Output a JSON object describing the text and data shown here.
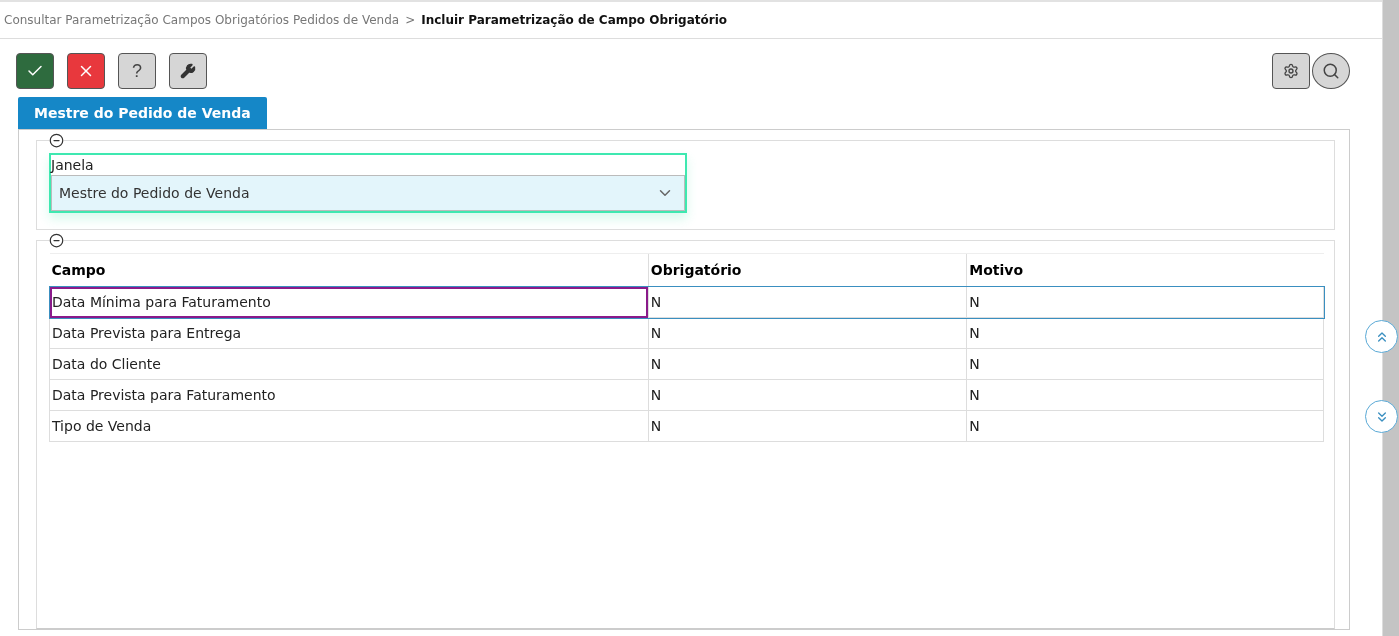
{
  "breadcrumb": {
    "parent": "Consultar Parametrização Campos Obrigatórios Pedidos de Venda",
    "separator": ">",
    "current": "Incluir Parametrização de Campo Obrigatório"
  },
  "help_button": {
    "label": "?"
  },
  "tab": {
    "label": "Mestre do Pedido de Venda"
  },
  "window_section": {
    "expanded": true,
    "label": "Janela",
    "value": "Mestre do Pedido de Venda"
  },
  "table": {
    "expanded": true,
    "columns": [
      "Campo",
      "Obrigatório",
      "Motivo"
    ],
    "rows": [
      {
        "campo": "Data Mínima para Faturamento",
        "obrigatorio": "N",
        "motivo": "N",
        "selected": true
      },
      {
        "campo": "Data Prevista para Entrega",
        "obrigatorio": "N",
        "motivo": "N",
        "selected": false
      },
      {
        "campo": "Data do Cliente",
        "obrigatorio": "N",
        "motivo": "N",
        "selected": false
      },
      {
        "campo": "Data Prevista para Faturamento",
        "obrigatorio": "N",
        "motivo": "N",
        "selected": false
      },
      {
        "campo": "Tipo de Venda",
        "obrigatorio": "N",
        "motivo": "N",
        "selected": false
      }
    ]
  }
}
